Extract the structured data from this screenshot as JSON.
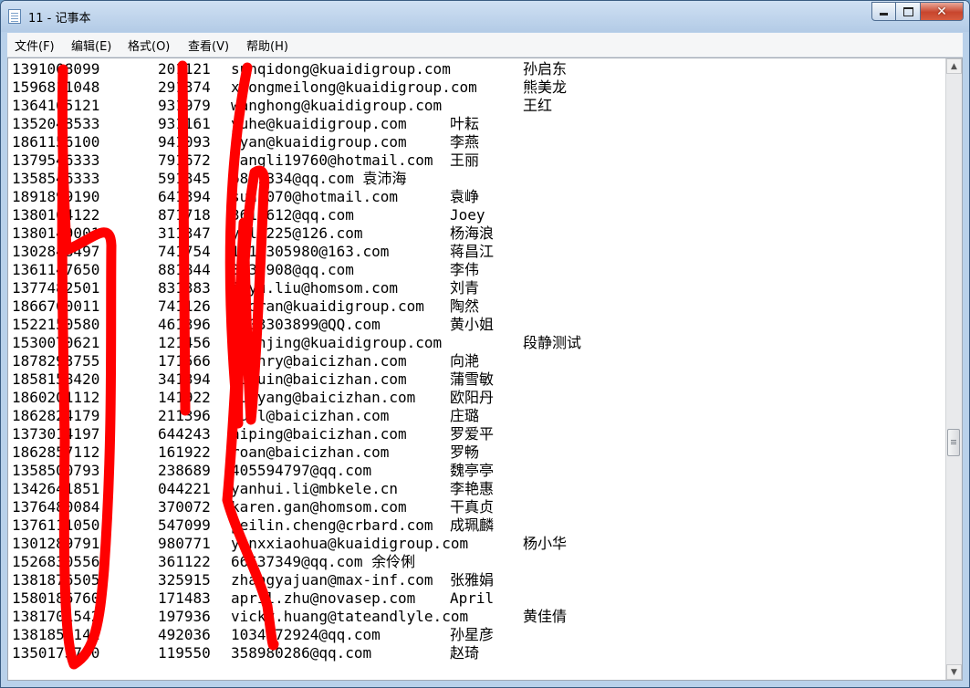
{
  "window": {
    "title": "11 - 记事本",
    "icon": "notepad-icon",
    "buttons": {
      "minimize": "minimize-icon",
      "maximize": "maximize-icon",
      "close": "close-icon"
    }
  },
  "menu": [
    "文件(F)",
    "编辑(E)",
    "格式(O)",
    "查看(V)",
    "帮助(H)"
  ],
  "rows": [
    [
      "1391008099",
      "201121",
      "sunqidong@kuaidigroup.com",
      "",
      "孙启东"
    ],
    [
      "1596811048",
      "291374",
      "xiongmeilong@kuaidigroup.com",
      "",
      "熊美龙"
    ],
    [
      "1364165121",
      "931979",
      "wanghong@kuaidigroup.com",
      "",
      "王红"
    ],
    [
      "1352048533",
      "931161",
      "yuhe@kuaidigroup.com",
      "叶耘",
      ""
    ],
    [
      "1861156100",
      "941093",
      "lyan@kuaidigroup.com",
      "李燕",
      ""
    ],
    [
      "1379546333",
      "791672",
      "wangli19760@hotmail.com",
      "王丽",
      ""
    ],
    [
      "1358546333",
      "591345",
      "6881334@qq.com 袁沛海",
      "",
      ""
    ],
    [
      "1891899190",
      "641394",
      "sun1070@hotmail.com",
      "袁峥",
      ""
    ],
    [
      "1380164122",
      "871718",
      "3615612@qq.com",
      "Joey",
      ""
    ],
    [
      "1380149001",
      "311347",
      "yhl9225@126.com",
      "杨海浪",
      ""
    ],
    [
      "1302848497",
      "741754",
      "1315305980@163.com",
      "蒋昌江",
      ""
    ],
    [
      "1361147650",
      "881844",
      "3130908@qq.com",
      "李伟",
      ""
    ],
    [
      "1377482501",
      "831383",
      "jqyu.liu@homsom.com",
      "刘青",
      ""
    ],
    [
      "1866700011",
      "741126",
      "taoran@kuaidigroup.com",
      "陶然",
      ""
    ],
    [
      "1522150580",
      "461396",
      "1503303899@QQ.com",
      "黄小姐",
      ""
    ],
    [
      "1530070621",
      "121456",
      "duanjing@kuaidigroup.com",
      "",
      "段静测试"
    ],
    [
      "1878293755",
      "171566",
      "chenry@baicizhan.com",
      "向滟",
      ""
    ],
    [
      "1858158420",
      "341394",
      "puxuin@baicizhan.com",
      "蒲雪敏",
      ""
    ],
    [
      "1860201112",
      "141922",
      "ouyyang@baicizhan.com",
      "欧阳丹",
      ""
    ],
    [
      "1862824179",
      "211396",
      "zuul@baicizhan.com",
      "庄璐",
      ""
    ],
    [
      "1373014197",
      "644243",
      "aiping@baicizhan.com",
      "罗爱平",
      ""
    ],
    [
      "1862857112",
      "161922",
      "roan@baicizhan.com",
      "罗畅",
      ""
    ],
    [
      "1358500793",
      "238689",
      "405594797@qq.com",
      "魏亭亭",
      ""
    ],
    [
      "1342641851",
      "044221",
      "yanhui.li@mbkele.cn",
      "李艳惠",
      ""
    ],
    [
      "1376480084",
      "370072",
      "karen.gan@homsom.com",
      "干真贞",
      ""
    ],
    [
      "1376111050",
      "547099",
      "peilin.cheng@crbard.com",
      "成珮麟",
      ""
    ],
    [
      "1301289791",
      "980771",
      "yanxxiaohua@kuaidigroup.com",
      "",
      "杨小华"
    ],
    [
      "1526830556",
      "361122",
      "66637349@qq.com 余伶俐",
      "",
      ""
    ],
    [
      "1381876505",
      "325915",
      "zhangyajuan@max-inf.com",
      "张雅娟",
      ""
    ],
    [
      "1580186760",
      "171483",
      "april.zhu@novasep.com",
      "April",
      ""
    ],
    [
      "1381701542",
      "197936",
      "vicky.huang@tateandlyle.com",
      "",
      "黄佳倩"
    ],
    [
      "1381859141",
      "492036",
      "1034872924@qq.com",
      "孙星彦",
      ""
    ],
    [
      "1350173700",
      "119550",
      "358980286@qq.com",
      "赵琦",
      ""
    ]
  ],
  "scrollbar": {
    "up": "scroll-up-icon",
    "down": "scroll-down-icon",
    "position": 0.58
  },
  "annotation_color": "#ff0000"
}
